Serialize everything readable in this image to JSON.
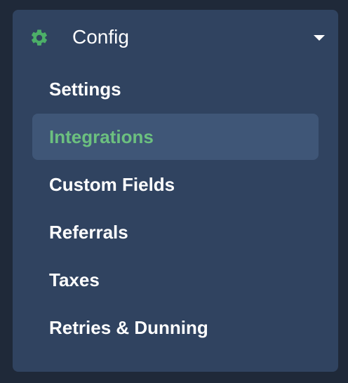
{
  "config_section": {
    "title": "Config",
    "icon": "gear-icon",
    "accent_color": "#4caf68",
    "expanded": true,
    "items": [
      {
        "label": "Settings",
        "active": false
      },
      {
        "label": "Integrations",
        "active": true
      },
      {
        "label": "Custom Fields",
        "active": false
      },
      {
        "label": "Referrals",
        "active": false
      },
      {
        "label": "Taxes",
        "active": false
      },
      {
        "label": "Retries & Dunning",
        "active": false
      }
    ]
  }
}
